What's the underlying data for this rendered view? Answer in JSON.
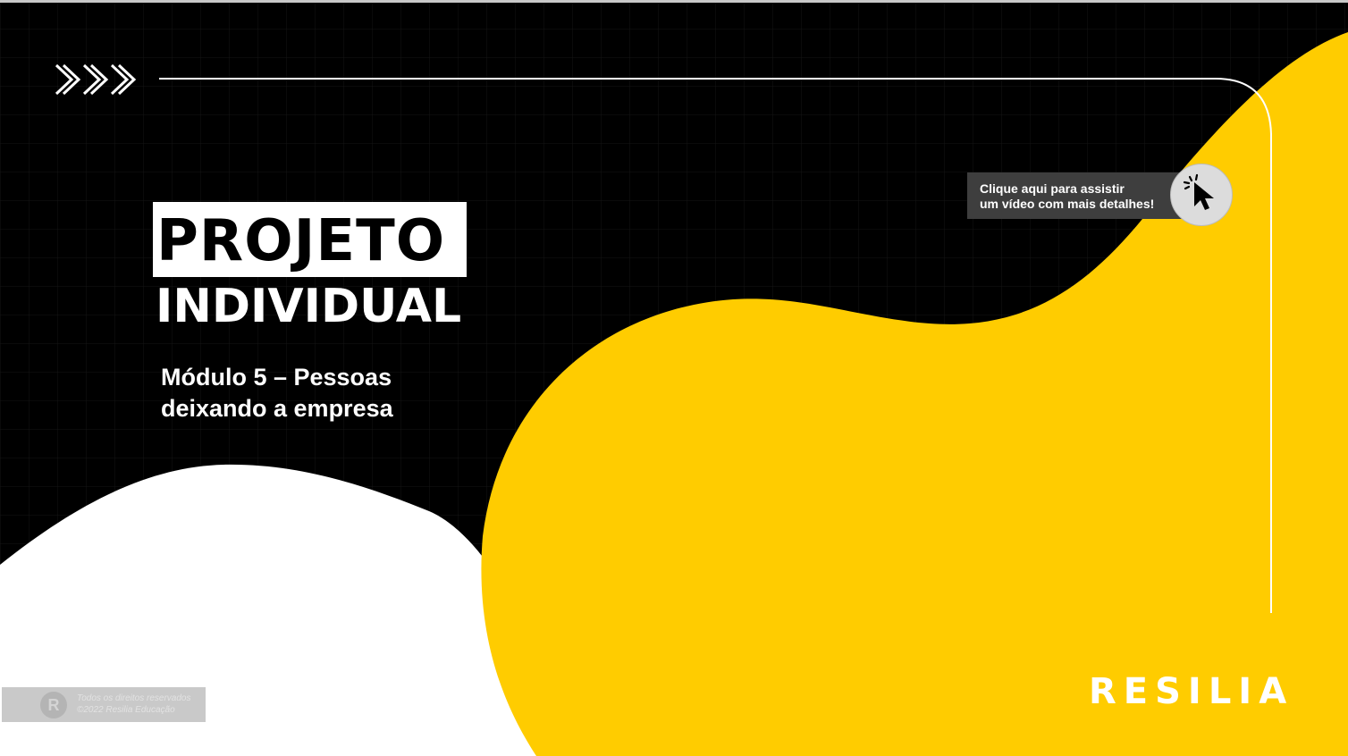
{
  "slide": {
    "title_line1": "PROJETO",
    "title_line2": "INDIVIDUAL",
    "subtitle_line1": "Módulo 5 – Pessoas",
    "subtitle_line2": "deixando a empresa",
    "icon": "triple-chevron-right-icon"
  },
  "video_link": {
    "line1": "Clique aqui para assistir",
    "line2": "um vídeo com mais detalhes!",
    "icon": "cursor-click-icon"
  },
  "brand": {
    "name": "RESILIA"
  },
  "footer": {
    "logo_letter": "R",
    "line1": "Todos os direitos reservados",
    "line2": "©2022 Resilia Educação"
  },
  "colors": {
    "background": "#000000",
    "accent_yellow": "#FFCC00",
    "white": "#FFFFFF",
    "button_bg": "#3E3E3E"
  }
}
